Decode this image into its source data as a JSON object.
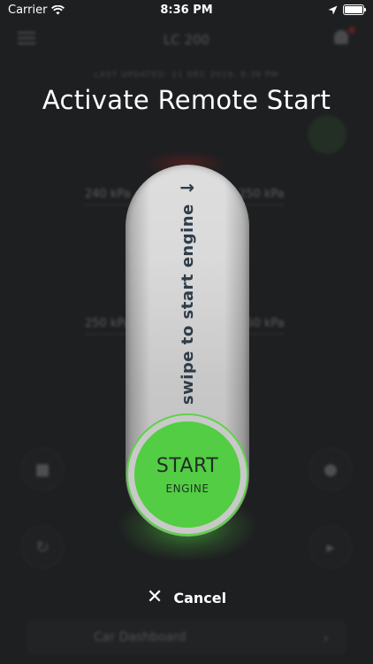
{
  "status_bar": {
    "carrier": "Carrier",
    "time": "8:36 PM"
  },
  "background": {
    "car_name": "LC 200",
    "last_updated": "LAST UPDATED: 21 DEC 2019, 8:36 PM",
    "tires": {
      "front_left": "240 kPa",
      "front_right": "250 kPa",
      "rear_left": "250 kPa",
      "rear_right": "250 kPa"
    },
    "dashboard_label": "Car Dashboard"
  },
  "remote_start": {
    "title": "Activate Remote Start",
    "swipe_hint": "swipe to start engine",
    "knob_title": "START",
    "knob_subtitle": "ENGINE",
    "cancel_label": "Cancel"
  },
  "colors": {
    "accent_green": "#53cd43",
    "track_gray": "#d8d8d8",
    "background": "#1e1f21"
  }
}
